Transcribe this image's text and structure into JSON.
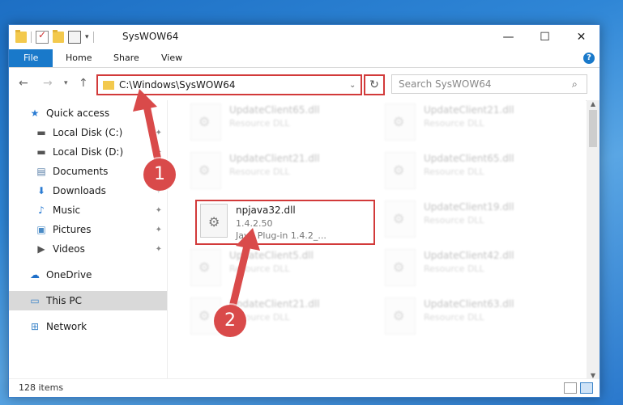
{
  "window": {
    "title": "SysWOW64",
    "controls": {
      "minimize": "—",
      "maximize": "☐",
      "close": "✕"
    },
    "quick_access_toolbar_caret": "▾"
  },
  "ribbon": {
    "tabs": [
      {
        "label": "File"
      },
      {
        "label": "Home"
      },
      {
        "label": "Share"
      },
      {
        "label": "View"
      }
    ],
    "help": "?"
  },
  "navigation": {
    "back": "←",
    "forward": "→",
    "recent": "▾",
    "up": "↑",
    "address_path": "C:\\Windows\\SysWOW64",
    "address_dropdown": "⌄",
    "refresh": "↻",
    "search_placeholder": "Search SysWOW64",
    "search_icon": "⌕"
  },
  "sidebar": {
    "items": [
      {
        "label": "Quick access",
        "icon": "star-icon",
        "glyph": "★",
        "color": "#2b7cd3",
        "pinned": false
      },
      {
        "label": "Local Disk (C:)",
        "icon": "drive-icon",
        "glyph": "▬",
        "color": "#555555",
        "pinned": true
      },
      {
        "label": "Local Disk (D:)",
        "icon": "drive-icon",
        "glyph": "▬",
        "color": "#555555",
        "pinned": true
      },
      {
        "label": "Documents",
        "icon": "document-icon",
        "glyph": "▤",
        "color": "#5a7fa8",
        "pinned": true
      },
      {
        "label": "Downloads",
        "icon": "download-icon",
        "glyph": "⬇",
        "color": "#2b7cd3",
        "pinned": true
      },
      {
        "label": "Music",
        "icon": "music-icon",
        "glyph": "♪",
        "color": "#2b7cd3",
        "pinned": true
      },
      {
        "label": "Pictures",
        "icon": "pictures-icon",
        "glyph": "▣",
        "color": "#4a8bc6",
        "pinned": true
      },
      {
        "label": "Videos",
        "icon": "video-icon",
        "glyph": "▶",
        "color": "#555555",
        "pinned": true
      },
      {
        "label": "OneDrive",
        "icon": "cloud-icon",
        "glyph": "☁",
        "color": "#1e6fc9",
        "pinned": false
      },
      {
        "label": "This PC",
        "icon": "computer-icon",
        "glyph": "▭",
        "color": "#3b84c9",
        "pinned": false,
        "selected": true
      },
      {
        "label": "Network",
        "icon": "network-icon",
        "glyph": "⊞",
        "color": "#3b84c9",
        "pinned": false
      }
    ],
    "pin_glyph": "📌"
  },
  "files": [
    {
      "name": "UpdateClient65.dll",
      "type": "Resource DLL",
      "faded": true
    },
    {
      "name": "UpdateClient21.dll",
      "type": "Resource DLL",
      "faded": true
    },
    {
      "name": "UpdateClient21.dll",
      "type": "Resource DLL",
      "faded": true
    },
    {
      "name": "UpdateClient65.dll",
      "type": "Resource DLL",
      "faded": true
    },
    {
      "name": "npjava32.dll",
      "version": "1.4.2.50",
      "type": "Java Plug-in 1.4.2_...",
      "faded": false,
      "highlighted": true
    },
    {
      "name": "UpdateClient19.dll",
      "type": "Resource DLL",
      "faded": true
    },
    {
      "name": "UpdateClient5.dll",
      "type": "Resource DLL",
      "faded": true
    },
    {
      "name": "UpdateClient42.dll",
      "type": "Resource DLL",
      "faded": true
    },
    {
      "name": "UpdateClient21.dll",
      "type": "Resource DLL",
      "faded": true
    },
    {
      "name": "UpdateClient63.dll",
      "type": "Resource DLL",
      "faded": true
    }
  ],
  "status": {
    "item_count": "128 items"
  },
  "annotations": {
    "step1": "1",
    "step2": "2",
    "color": "#d94a4a"
  }
}
